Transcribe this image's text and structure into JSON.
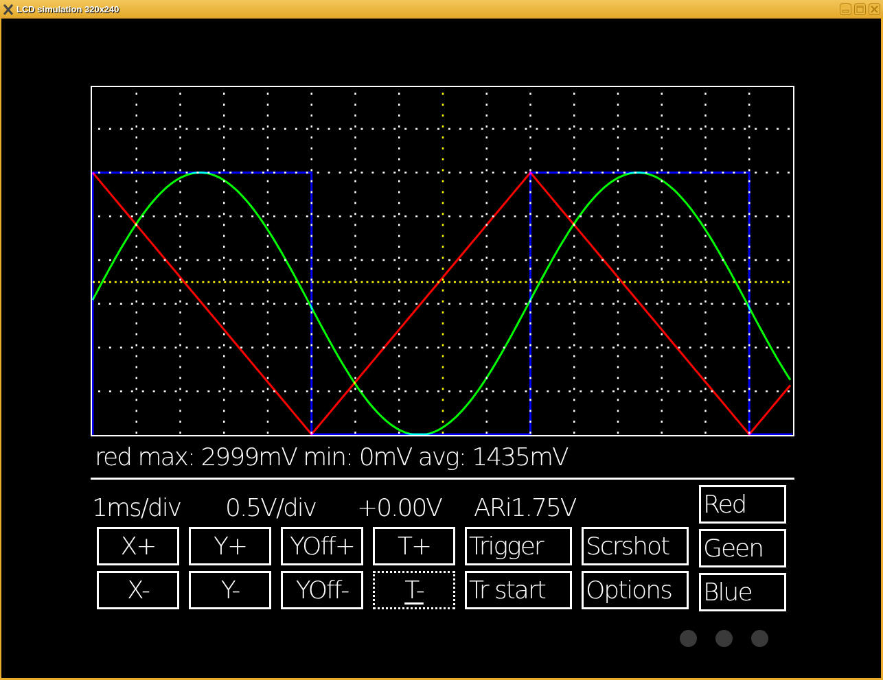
{
  "window": {
    "title": "LCD simulation 320x240"
  },
  "scope": {
    "traces": [
      {
        "kind": "square",
        "color": "#0000ff"
      },
      {
        "kind": "sine",
        "color": "#00ff00"
      },
      {
        "kind": "triangle",
        "color": "#ff0000"
      }
    ]
  },
  "stats": "red max: 2999mV min: 0mV avg: 1435mV",
  "settings": [
    "1ms/div",
    "0.5V/div",
    "+0.00V",
    "ARi1.75V"
  ],
  "control_buttons": [
    [
      {
        "label": "X+",
        "focused": false
      },
      {
        "label": "Y+",
        "focused": false
      },
      {
        "label": "YOff+",
        "focused": false
      },
      {
        "label": "T+",
        "focused": false
      },
      {
        "label": "Trigger",
        "focused": false
      },
      {
        "label": "Scrshot",
        "focused": false
      }
    ],
    [
      {
        "label": "X-",
        "focused": false
      },
      {
        "label": "Y-",
        "focused": false
      },
      {
        "label": "YOff-",
        "focused": false
      },
      {
        "label": "T-",
        "focused": true
      },
      {
        "label": "Tr start",
        "focused": false
      },
      {
        "label": "Options",
        "focused": false
      }
    ]
  ],
  "channel_buttons": [
    {
      "label": "Red",
      "focused": false
    },
    {
      "label": "Geen",
      "focused": false
    },
    {
      "label": "Blue",
      "focused": false
    }
  ],
  "leds": [
    {
      "lit": false
    },
    {
      "lit": false
    },
    {
      "lit": false
    }
  ]
}
